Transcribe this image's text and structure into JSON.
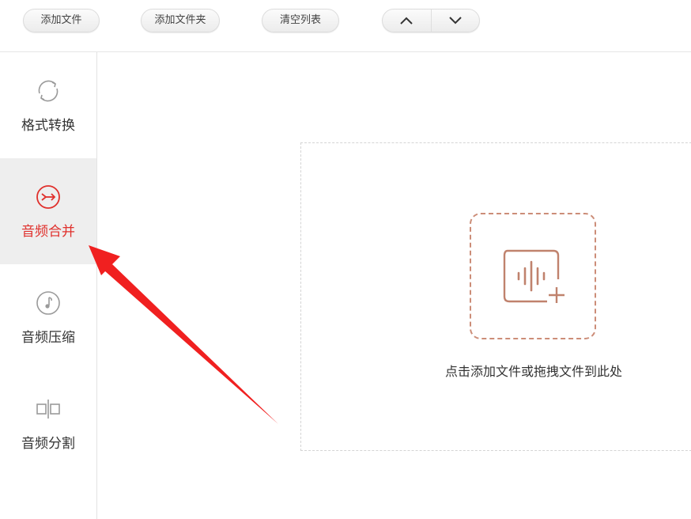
{
  "toolbar": {
    "add_file": "添加文件",
    "add_folder": "添加文件夹",
    "clear_list": "清空列表",
    "move_up_icon": "chevron-up-icon",
    "move_down_icon": "chevron-down-icon"
  },
  "sidebar": {
    "items": [
      {
        "label": "格式转换",
        "icon": "convert-icon",
        "active": false
      },
      {
        "label": "音频合并",
        "icon": "merge-icon",
        "active": true
      },
      {
        "label": "音频压缩",
        "icon": "music-note-icon",
        "active": false
      },
      {
        "label": "音频分割",
        "icon": "split-icon",
        "active": false
      }
    ]
  },
  "main": {
    "drop_hint": "点击添加文件或拖拽文件到此处",
    "add_icon": "audio-add-icon"
  },
  "colors": {
    "accent": "#e0302c",
    "drop_accent": "#cc8d78",
    "arrow": "#f02020"
  }
}
